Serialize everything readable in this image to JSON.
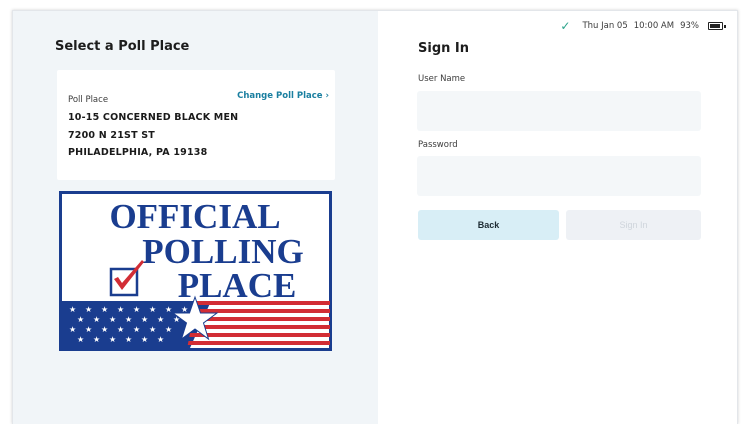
{
  "left": {
    "title": "Select a Poll Place",
    "card": {
      "label": "Poll Place",
      "change_link": "Change Poll Place ›",
      "address_line1": "10-15 CONCERNED BLACK MEN",
      "address_line2": "7200 N 21ST ST",
      "address_line3": "PHILADELPHIA, PA 19138"
    },
    "sign": {
      "line1": "OFFICIAL",
      "line2": "POLLING",
      "line3": "PLACE",
      "colors": {
        "blue": "#1a3d8f",
        "red": "#d22d35",
        "white": "#ffffff"
      }
    }
  },
  "status": {
    "date": "Thu Jan 05",
    "time": "10:00 AM",
    "battery": "93%",
    "check_icon": "check-icon",
    "battery_icon": "battery-icon"
  },
  "signin": {
    "title": "Sign In",
    "username_label": "User Name",
    "username_value": "",
    "password_label": "Password",
    "password_value": "",
    "back_label": "Back",
    "signin_label": "Sign In"
  },
  "colors": {
    "accent": "#1a7fa0",
    "check": "#2aa38a",
    "left_pane_bg": "#f1f5f8",
    "back_button_bg": "#d8eef6",
    "signin_button_bg": "#eef1f5"
  }
}
